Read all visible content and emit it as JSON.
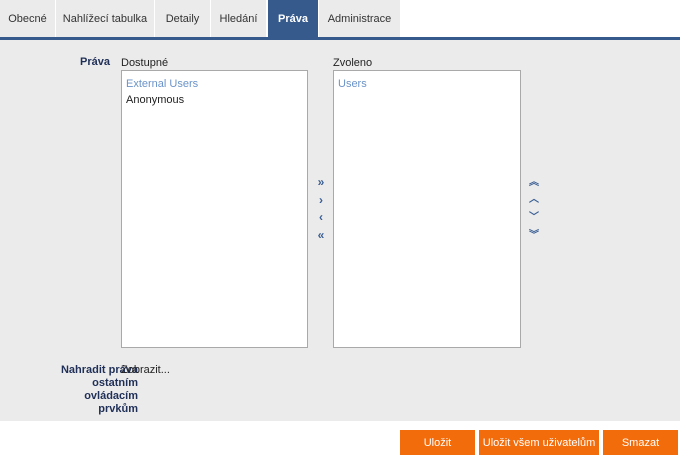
{
  "tabs": [
    {
      "label": "Obecné"
    },
    {
      "label": "Nahlížecí tabulka"
    },
    {
      "label": "Detaily"
    },
    {
      "label": "Hledání"
    },
    {
      "label": "Práva",
      "active": true
    },
    {
      "label": "Administrace"
    }
  ],
  "rights": {
    "label": "Práva",
    "available_caption": "Dostupné",
    "selected_caption": "Zvoleno",
    "available_items": [
      {
        "label": "External Users",
        "highlighted": true
      },
      {
        "label": "Anonymous"
      }
    ],
    "selected_items": [
      {
        "label": "Users",
        "highlighted": true
      }
    ],
    "move_buttons": {
      "move_all_right": "»",
      "move_right": "›",
      "move_left": "‹",
      "move_all_left": "«"
    },
    "order_buttons": {
      "move_top": "︽",
      "move_up": "︿",
      "move_down": "﹀",
      "move_bottom": "︾"
    }
  },
  "replace_rights": {
    "label": "Nahradit práva ostatním ovládacím prvkům",
    "label_lines": [
      "Nahradit práva",
      "ostatním",
      "ovládacím",
      "prvkům"
    ],
    "link": "Zobrazit..."
  },
  "footer": {
    "save": "Uložit",
    "save_all_users": "Uložit všem uživatelům",
    "delete": "Smazat"
  },
  "colors": {
    "accent": "#365a8c",
    "button": "#f36c0c",
    "highlight_item": "#6a93c9",
    "panel_bg": "#ebebeb"
  }
}
